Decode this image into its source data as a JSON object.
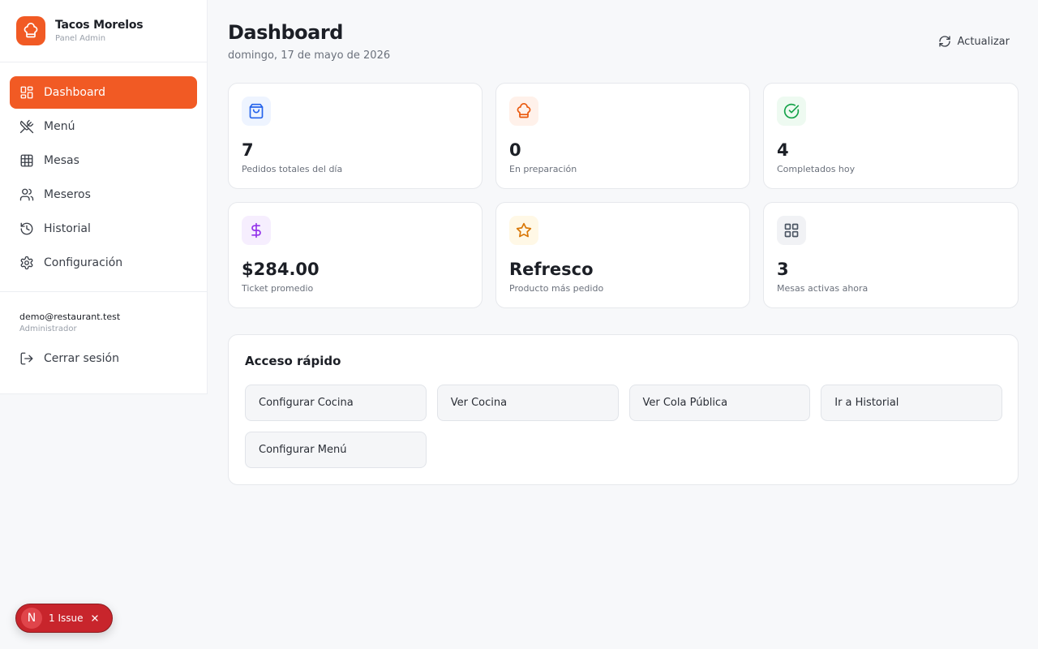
{
  "brand": {
    "name": "Tacos Morelos",
    "subtitle": "Panel Admin",
    "accent": "#f15a24"
  },
  "nav": {
    "items": [
      {
        "label": "Dashboard",
        "icon": "dashboard-icon",
        "active": true
      },
      {
        "label": "Menú",
        "icon": "utensils-icon"
      },
      {
        "label": "Mesas",
        "icon": "grid-icon"
      },
      {
        "label": "Meseros",
        "icon": "users-icon"
      },
      {
        "label": "Historial",
        "icon": "history-icon"
      },
      {
        "label": "Configuración",
        "icon": "gear-icon"
      }
    ]
  },
  "user": {
    "email": "demo@restaurant.test",
    "role": "Administrador",
    "logout_label": "Cerrar sesión"
  },
  "header": {
    "title": "Dashboard",
    "date": "domingo, 17 de mayo de 2026",
    "refresh_label": "Actualizar"
  },
  "stats": [
    {
      "value": "7",
      "label": "Pedidos totales del día",
      "icon": "shopping-bag-icon",
      "color": "#2563eb"
    },
    {
      "value": "0",
      "label": "En preparación",
      "icon": "chef-hat-icon",
      "color": "#ea580c"
    },
    {
      "value": "4",
      "label": "Completados hoy",
      "icon": "check-circle-icon",
      "color": "#16a34a"
    },
    {
      "value": "$284.00",
      "label": "Ticket promedio",
      "icon": "dollar-icon",
      "color": "#9333ea"
    },
    {
      "value": "Refresco",
      "label": "Producto más pedido",
      "icon": "star-icon",
      "color": "#d97706"
    },
    {
      "value": "3",
      "label": "Mesas activas ahora",
      "icon": "grid-icon",
      "color": "#4b5563"
    }
  ],
  "quick_access": {
    "title": "Acceso rápido",
    "buttons": [
      "Configurar Cocina",
      "Ver Cocina",
      "Ver Cola Pública",
      "Ir a Historial",
      "Configurar Menú"
    ]
  },
  "issue_badge": {
    "letter": "N",
    "label": "1 Issue",
    "color": "#c8252c"
  }
}
